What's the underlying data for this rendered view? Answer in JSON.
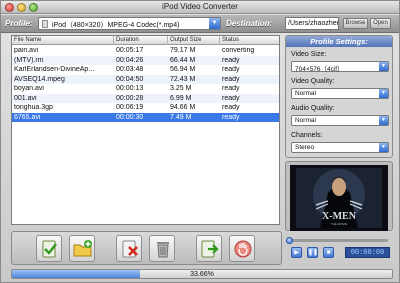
{
  "window": {
    "title": "iPod Video Converter"
  },
  "toolbar": {
    "profile_label": "Profile:",
    "profile_value": "iPod（480×320）MPEG-4 Codec(*.mp4)",
    "destination_label": "Destination:",
    "destination_value": "/Users/zhaozhen",
    "browse_label": "Browse",
    "open_label": "Open"
  },
  "table": {
    "headers": [
      "File Name",
      "Duration",
      "Output Size",
      "Status"
    ],
    "rows": [
      {
        "name": "pain.avi",
        "duration": "00:05:17",
        "size": "79.17 M",
        "status": "converting"
      },
      {
        "name": "(MTV).rm",
        "duration": "00:04:26",
        "size": "66.44 M",
        "status": "ready"
      },
      {
        "name": "KarlErlandsen-DivineAp...",
        "duration": "00:03:48",
        "size": "56.94 M",
        "status": "ready"
      },
      {
        "name": "AVSEQ14.mpeg",
        "duration": "00:04:50",
        "size": "72.43 M",
        "status": "ready"
      },
      {
        "name": "boyan.avi",
        "duration": "00:00:13",
        "size": "3.25 M",
        "status": "ready"
      },
      {
        "name": "001.avi",
        "duration": "00:00:28",
        "size": "6.99 M",
        "status": "ready"
      },
      {
        "name": "tonghua.3gp",
        "duration": "00:06:19",
        "size": "94.66 M",
        "status": "ready"
      },
      {
        "name": "6765.avi",
        "duration": "00:00:30",
        "size": "7.49 M",
        "status": "ready"
      }
    ],
    "selected_index": 7
  },
  "profile_settings": {
    "title": "Profile Settings:",
    "video_size_label": "Video Size:",
    "video_size_value": "704×576（4cif）",
    "video_quality_label": "Video Quality:",
    "video_quality_value": "Normal",
    "audio_quality_label": "Audio Quality:",
    "audio_quality_value": "Normal",
    "channels_label": "Channels:",
    "channels_value": "Stereo"
  },
  "preview": {
    "movie_title": "X-MEN",
    "movie_subtitle": "THE MOVIE",
    "timecode": "00:00:00"
  },
  "progress": {
    "percent_text": "33.66%",
    "fraction": 0.3366
  },
  "icons": {
    "actions": [
      "convert-icon",
      "add-file-icon",
      "remove-file-icon",
      "clear-list-icon",
      "export-icon",
      "stop-icon"
    ],
    "player": [
      "play-icon",
      "pause-icon",
      "stop-icon"
    ]
  },
  "colors": {
    "accent": "#3b78e7",
    "panel_header": "#5273b6",
    "selection": "#3b78e7"
  }
}
